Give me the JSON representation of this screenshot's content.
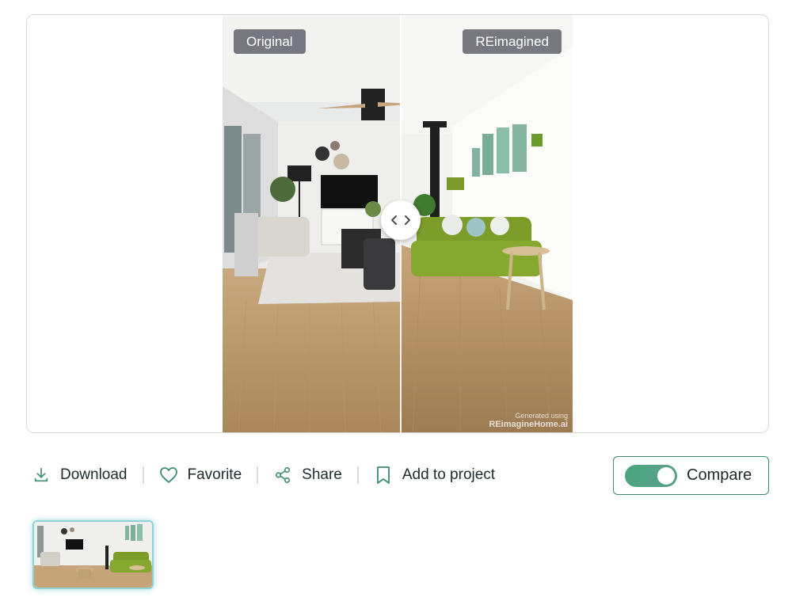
{
  "viewer": {
    "label_original": "Original",
    "label_reimagined": "REimagined",
    "watermark_line1": "Generated using",
    "watermark_line2": "REimagineHome.ai",
    "handle_icon": "chevrons-left-right-icon"
  },
  "actions": [
    {
      "label": "Download",
      "icon": "download-icon"
    },
    {
      "label": "Favorite",
      "icon": "heart-icon"
    },
    {
      "label": "Share",
      "icon": "share-icon"
    },
    {
      "label": "Add to project",
      "icon": "bookmark-icon"
    }
  ],
  "compare": {
    "label": "Compare",
    "enabled": true
  },
  "colors": {
    "accent": "#3d8c6e",
    "icon": "#3d8c6e",
    "toggle": "#4aa57c",
    "thumb_border": "#8fd1d6"
  }
}
